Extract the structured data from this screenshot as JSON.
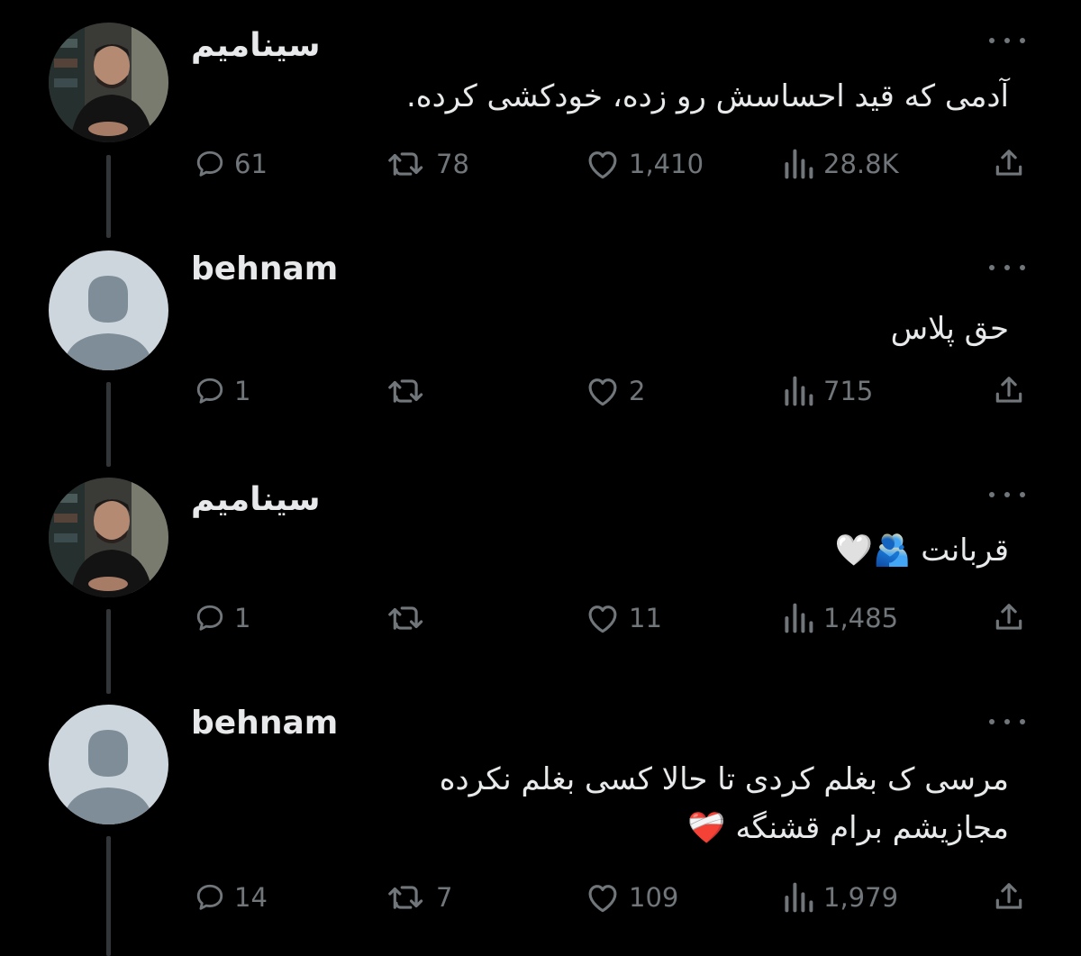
{
  "tweets": [
    {
      "username": "سینامیم",
      "avatar": "photo-avatar",
      "text_lines": [
        "آدمی که قید احساسش رو زده، خودکشی کرده."
      ],
      "replies": "61",
      "retweets": "78",
      "likes": "1,410",
      "views": "28.8K"
    },
    {
      "username": "behnam",
      "avatar": "default-avatar",
      "text_lines": [
        "حق پلاس"
      ],
      "replies": "1",
      "retweets": "",
      "likes": "2",
      "views": "715"
    },
    {
      "username": "سینامیم",
      "avatar": "photo-avatar",
      "text_lines": [
        "قربانت 🫂🤍"
      ],
      "replies": "1",
      "retweets": "",
      "likes": "11",
      "views": "1,485"
    },
    {
      "username": "behnam",
      "avatar": "default-avatar",
      "text_lines": [
        "مرسی ک بغلم کردی تا حالا کسی بغلم نکرده",
        "مجازیشم برام قشنگه ❤️‍🩹"
      ],
      "replies": "14",
      "retweets": "7",
      "likes": "109",
      "views": "1,979"
    }
  ],
  "icons": {
    "reply": "reply-icon",
    "retweet": "retweet-icon",
    "like": "heart-icon",
    "views": "views-icon",
    "share": "share-icon",
    "more": "more-icon"
  },
  "colors": {
    "background": "#000000",
    "text": "#e7e9ea",
    "muted": "#71767b",
    "thread_line": "#333639"
  }
}
